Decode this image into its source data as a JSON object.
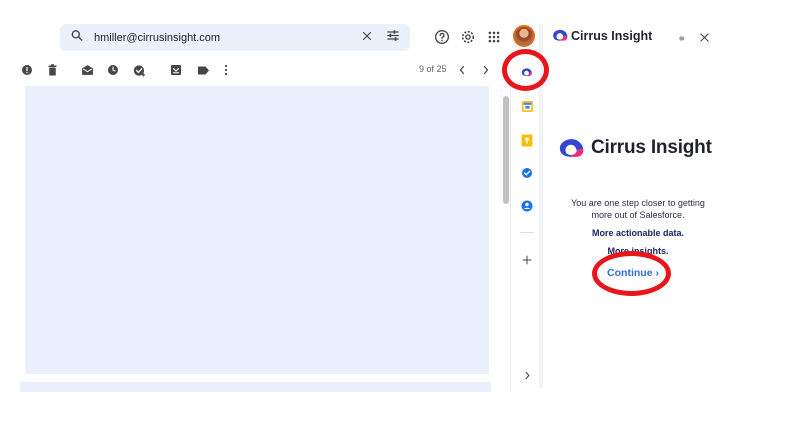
{
  "search": {
    "value": "hmiller@cirrusinsight.com",
    "icon": "search-icon",
    "clear_icon": "close-icon",
    "filter_icon": "tune-icon"
  },
  "header": {
    "help_icon": "help-icon",
    "settings_icon": "gear-icon",
    "apps_icon": "apps-grid-icon",
    "avatar": "user-avatar"
  },
  "toolbar": {
    "icons": [
      "report-spam-icon",
      "delete-icon",
      "mark-unread-icon",
      "snooze-icon",
      "add-task-icon",
      "move-to-icon",
      "label-icon",
      "more-vert-icon"
    ],
    "pager": "9 of 25",
    "prev_icon": "chevron-left-icon",
    "next_icon": "chevron-right-icon"
  },
  "side_panel": {
    "icons": [
      "cirrus-insight-icon",
      "calendar-icon",
      "keep-icon",
      "tasks-icon",
      "contacts-icon",
      "add-icon",
      "expand-icon"
    ]
  },
  "addon": {
    "title": "Cirrus Insight",
    "brand": "Cirrus Insight",
    "tagline_line1": "You are one step closer to getting",
    "tagline_line2": "more out of Salesforce.",
    "bullet1": "More actionable data.",
    "bullet2": "More insights.",
    "continue_label": "Continue ›",
    "pin_icon": "pin-icon",
    "close_icon": "close-icon"
  },
  "colors": {
    "accent_blue": "#2f6fd6",
    "highlight_red": "#e8161b",
    "pane_bg": "#eaf1fc"
  }
}
